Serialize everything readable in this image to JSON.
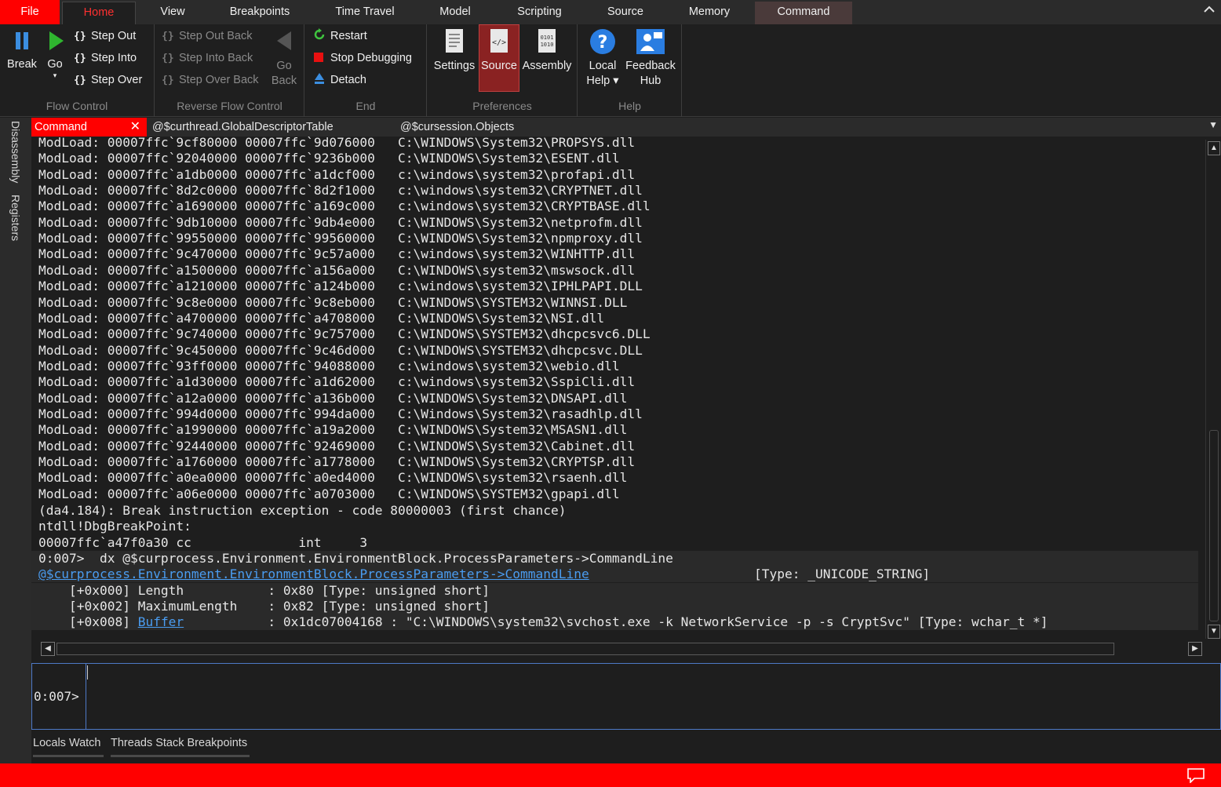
{
  "menu": {
    "file": "File",
    "tabs": [
      "Home",
      "View",
      "Breakpoints",
      "Time Travel",
      "Model",
      "Scripting",
      "Source",
      "Memory",
      "Command"
    ]
  },
  "ribbon": {
    "flow_control": {
      "label": "Flow Control",
      "break": "Break",
      "go": "Go",
      "step_out": "Step Out",
      "step_into": "Step Into",
      "step_over": "Step Over"
    },
    "reverse_flow_control": {
      "label": "Reverse Flow Control",
      "step_out_back": "Step Out Back",
      "step_into_back": "Step Into Back",
      "step_over_back": "Step Over Back",
      "go_back_line1": "Go",
      "go_back_line2": "Back"
    },
    "end": {
      "label": "End",
      "restart": "Restart",
      "stop_debugging": "Stop Debugging",
      "detach": "Detach"
    },
    "preferences": {
      "label": "Preferences",
      "settings": "Settings",
      "source": "Source",
      "assembly": "Assembly"
    },
    "help": {
      "label": "Help",
      "local_help_line1": "Local",
      "local_help_line2": "Help ▾",
      "feedback_hub_line1": "Feedback",
      "feedback_hub_line2": "Hub"
    }
  },
  "side_tabs": [
    "Disassembly",
    "Registers"
  ],
  "doc_tabs": [
    "Command",
    "@$curthread.GlobalDescriptorTable",
    "@$cursession.Objects"
  ],
  "output": {
    "modloads": [
      "ModLoad: 00007ffc`9cf80000 00007ffc`9d076000   C:\\WINDOWS\\System32\\PROPSYS.dll",
      "ModLoad: 00007ffc`92040000 00007ffc`9236b000   C:\\WINDOWS\\System32\\ESENT.dll",
      "ModLoad: 00007ffc`a1db0000 00007ffc`a1dcf000   c:\\windows\\system32\\profapi.dll",
      "ModLoad: 00007ffc`8d2c0000 00007ffc`8d2f1000   c:\\windows\\system32\\CRYPTNET.dll",
      "ModLoad: 00007ffc`a1690000 00007ffc`a169c000   c:\\windows\\system32\\CRYPTBASE.dll",
      "ModLoad: 00007ffc`9db10000 00007ffc`9db4e000   C:\\WINDOWS\\System32\\netprofm.dll",
      "ModLoad: 00007ffc`99550000 00007ffc`99560000   C:\\WINDOWS\\System32\\npmproxy.dll",
      "ModLoad: 00007ffc`9c470000 00007ffc`9c57a000   c:\\windows\\system32\\WINHTTP.dll",
      "ModLoad: 00007ffc`a1500000 00007ffc`a156a000   C:\\WINDOWS\\system32\\mswsock.dll",
      "ModLoad: 00007ffc`a1210000 00007ffc`a124b000   c:\\windows\\system32\\IPHLPAPI.DLL",
      "ModLoad: 00007ffc`9c8e0000 00007ffc`9c8eb000   C:\\WINDOWS\\SYSTEM32\\WINNSI.DLL",
      "ModLoad: 00007ffc`a4700000 00007ffc`a4708000   C:\\WINDOWS\\System32\\NSI.dll",
      "ModLoad: 00007ffc`9c740000 00007ffc`9c757000   C:\\WINDOWS\\SYSTEM32\\dhcpcsvc6.DLL",
      "ModLoad: 00007ffc`9c450000 00007ffc`9c46d000   C:\\WINDOWS\\SYSTEM32\\dhcpcsvc.DLL",
      "ModLoad: 00007ffc`93ff0000 00007ffc`94088000   c:\\windows\\system32\\webio.dll",
      "ModLoad: 00007ffc`a1d30000 00007ffc`a1d62000   c:\\windows\\system32\\SspiCli.dll",
      "ModLoad: 00007ffc`a12a0000 00007ffc`a136b000   C:\\WINDOWS\\System32\\DNSAPI.dll",
      "ModLoad: 00007ffc`994d0000 00007ffc`994da000   C:\\Windows\\System32\\rasadhlp.dll",
      "ModLoad: 00007ffc`a1990000 00007ffc`a19a2000   C:\\WINDOWS\\System32\\MSASN1.dll",
      "ModLoad: 00007ffc`92440000 00007ffc`92469000   C:\\WINDOWS\\System32\\Cabinet.dll",
      "ModLoad: 00007ffc`a1760000 00007ffc`a1778000   C:\\WINDOWS\\System32\\CRYPTSP.dll",
      "ModLoad: 00007ffc`a0ea0000 00007ffc`a0ed4000   C:\\WINDOWS\\system32\\rsaenh.dll",
      "ModLoad: 00007ffc`a06e0000 00007ffc`a0703000   C:\\WINDOWS\\SYSTEM32\\gpapi.dll"
    ],
    "exception_line": "(da4.184): Break instruction exception - code 80000003 (first chance)",
    "break_symbol": "ntdll!DbgBreakPoint:",
    "break_instr": "00007ffc`a47f0a30 cc              int     3",
    "dx_command": "0:007>  dx @$curprocess.Environment.EnvironmentBlock.ProcessParameters->CommandLine",
    "dx_link": "@$curprocess.Environment.EnvironmentBlock.ProcessParameters->CommandLine",
    "dx_type": "[Type: _UNICODE_STRING]",
    "field1": "    [+0x000] Length           : 0x80 [Type: unsigned short]",
    "field2": "    [+0x002] MaximumLength    : 0x82 [Type: unsigned short]",
    "field3_prefix": "    [+0x008] ",
    "field3_link": "Buffer",
    "field3_suffix": "           : 0x1dc07004168 : \"C:\\WINDOWS\\system32\\svchost.exe -k NetworkService -p -s CryptSvc\" [Type: wchar_t *]"
  },
  "input": {
    "prompt": "0:007>",
    "value": ""
  },
  "bottom_tabs": [
    "Locals Watch",
    "Threads Stack Breakpoints"
  ],
  "colors": {
    "accent": "#ff0000",
    "link": "#4a9cf0",
    "input_border": "#4e79c7"
  }
}
